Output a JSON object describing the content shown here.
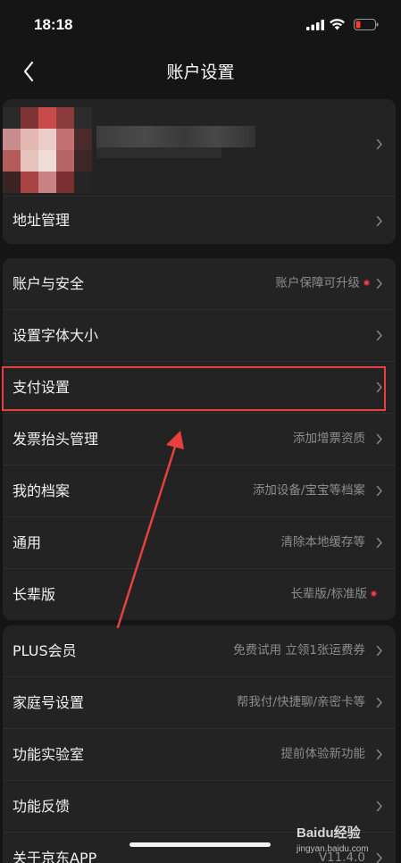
{
  "status": {
    "time": "18:18"
  },
  "nav": {
    "title": "账户设置"
  },
  "profile": {
    "address_label": "地址管理"
  },
  "settings": [
    {
      "label": "账户与安全",
      "hint": "账户保障可升级",
      "dot": true
    },
    {
      "label": "设置字体大小",
      "hint": "",
      "dot": false
    },
    {
      "label": "支付设置",
      "hint": "",
      "dot": false
    },
    {
      "label": "发票抬头管理",
      "hint": "添加增票资质",
      "dot": false
    },
    {
      "label": "我的档案",
      "hint": "添加设备/宝宝等档案",
      "dot": false
    },
    {
      "label": "通用",
      "hint": "清除本地缓存等",
      "dot": false
    },
    {
      "label": "长辈版",
      "hint": "长辈版/标准版",
      "dot": true
    }
  ],
  "more": [
    {
      "label": "PLUS会员",
      "hint": "免费试用 立领1张运费券"
    },
    {
      "label": "家庭号设置",
      "hint": "帮我付/快捷聊/亲密卡等"
    },
    {
      "label": "功能实验室",
      "hint": "提前体验新功能"
    },
    {
      "label": "功能反馈",
      "hint": ""
    },
    {
      "label": "关于京东APP",
      "hint": "V11.4.0"
    }
  ],
  "watermark": {
    "brand": "Baidu经验",
    "site": "jingyan.baidu.com"
  },
  "colors": {
    "accent": "#e8403e",
    "background": "#151515",
    "card": "#232323"
  }
}
